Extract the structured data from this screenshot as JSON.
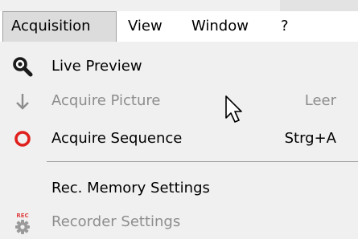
{
  "menubar": {
    "items": [
      {
        "label": "Acquisition",
        "active": true
      },
      {
        "label": "View",
        "active": false
      },
      {
        "label": "Window",
        "active": false
      },
      {
        "label": "?",
        "active": false
      }
    ]
  },
  "menu": {
    "items": [
      {
        "label": "Live Preview",
        "shortcut": "",
        "icon": "magnifier-icon",
        "enabled": true
      },
      {
        "label": "Acquire Picture",
        "shortcut": "Leer",
        "icon": "arrow-down-icon",
        "enabled": false
      },
      {
        "label": "Acquire Sequence",
        "shortcut": "Strg+A",
        "icon": "red-circle-icon",
        "enabled": true
      },
      {
        "label": "Rec. Memory Settings",
        "shortcut": "",
        "icon": "",
        "enabled": true
      },
      {
        "label": "Recorder Settings",
        "shortcut": "",
        "icon": "rec-gear-icon",
        "enabled": false
      }
    ]
  },
  "icons": {
    "rec_badge": "REC"
  },
  "colors": {
    "menu_background": "#f0f0f0",
    "menubar_background": "#ffffff",
    "active_menu_background": "#dcdcdc",
    "disabled_text": "#8d8d8d",
    "sequence_icon": "#e0201c",
    "rec_text": "#e04040"
  }
}
